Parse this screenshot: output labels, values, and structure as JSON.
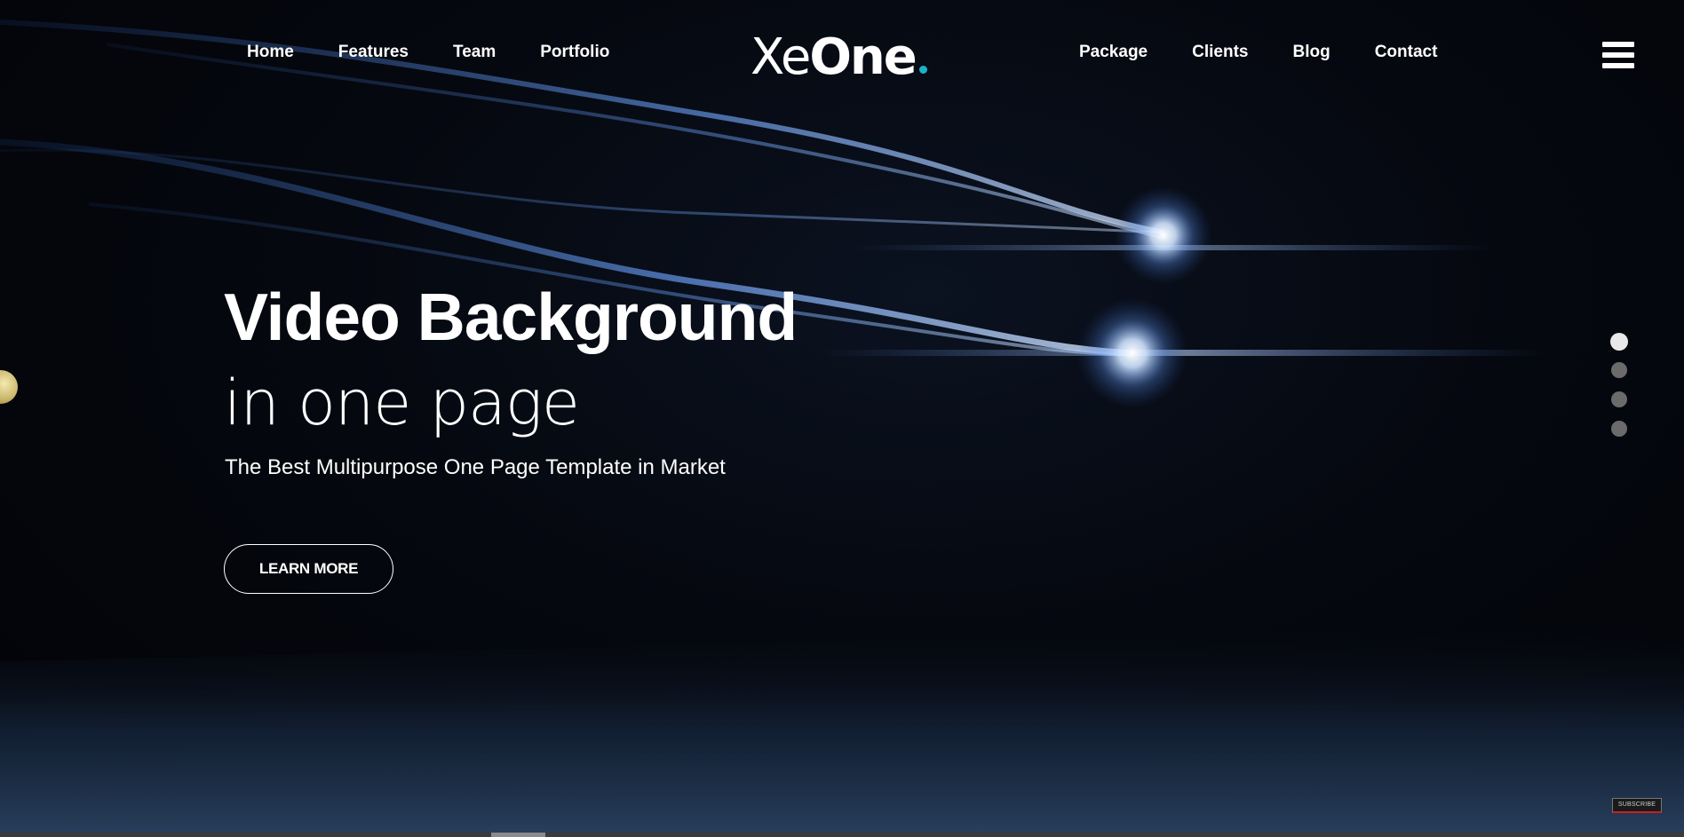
{
  "nav": {
    "left": [
      "Home",
      "Features",
      "Team",
      "Portfolio"
    ],
    "right": [
      "Package",
      "Clients",
      "Blog",
      "Contact"
    ]
  },
  "logo": {
    "light": "Xe",
    "bold": "One",
    "dot_color": "#19b4c8"
  },
  "menu_icon": "hamburger-icon",
  "hero": {
    "title": "Video Background",
    "subtitle": "in one page",
    "tagline": "The Best Multipurpose One Page Template in Market",
    "cta_label": "LEARN MORE"
  },
  "section_nav": {
    "count": 4,
    "active_index": 0
  },
  "video": {
    "subscribe_label": "SUBSCRIBE",
    "progress": 0.03
  },
  "colors": {
    "background": "#03050a",
    "text": "#ffffff",
    "accent": "#19b4c8",
    "light_streak": "#6fa6ff"
  }
}
